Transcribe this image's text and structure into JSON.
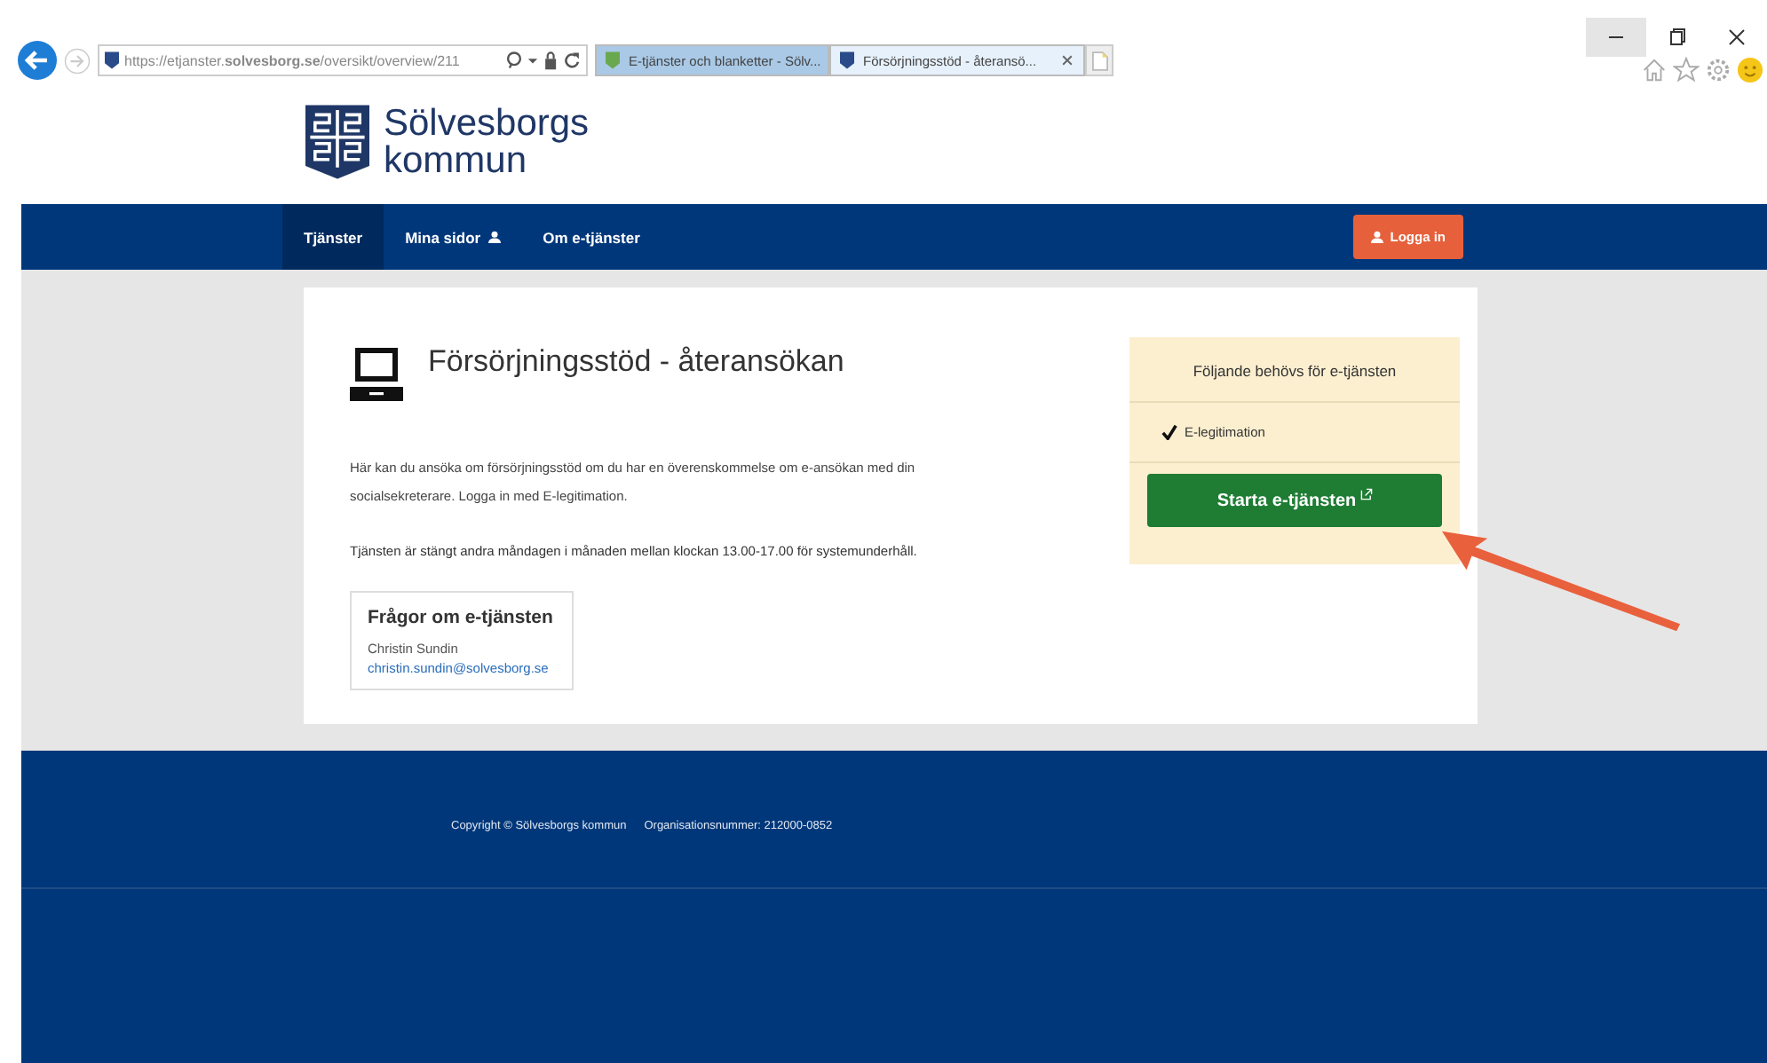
{
  "browser": {
    "url": "https://etjanster.**solvesborg.se**/oversikt/overview/211",
    "tabs": [
      {
        "title": "E-tjänster och blanketter - Sölv...",
        "selected": false
      },
      {
        "title": "Försörjningsstöd - återansö...",
        "selected": true
      }
    ]
  },
  "logo": {
    "line1": "Sölvesborgs",
    "line2": "kommun"
  },
  "nav": {
    "items": [
      {
        "label": "Tjänster",
        "selected": true,
        "kind": "plain"
      },
      {
        "label": "Mina sidor",
        "selected": false,
        "kind": "user"
      },
      {
        "label": "Om e-tjänster",
        "selected": false,
        "kind": "plain"
      }
    ],
    "login": "Logga in"
  },
  "service": {
    "title": "Försörjningsstöd - återansökan",
    "description": "Här kan du ansöka om försörjningsstöd om du har en överenskommelse om e-ansökan med din socialsekreterare. Logga in med E-legitimation.",
    "notice": "Tjänsten är stängt andra måndagen i månaden mellan klockan 13.00-17.00 för systemunderhåll.",
    "contact": {
      "heading": "Frågor om e-tjänsten",
      "name": "Christin Sundin",
      "email": "christin.sundin@solvesborg.se"
    }
  },
  "requirements": {
    "heading": "Följande behövs för e-tjänsten",
    "items": [
      {
        "label": "E-legitimation",
        "checked": true
      }
    ],
    "button": "Starta e-tjänsten"
  },
  "footer": {
    "copyright": "Copyright © Sölvesborgs kommun",
    "org": "Organisationsnummer: 212000-0852"
  }
}
